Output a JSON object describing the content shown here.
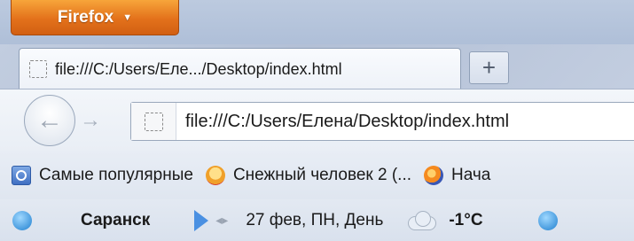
{
  "menu": {
    "firefox_label": "Firefox",
    "arrow": "▼"
  },
  "tab": {
    "title": "file:///C:/Users/Еле.../Desktop/index.html",
    "new_tab_label": "+"
  },
  "nav": {
    "back_glyph": "←",
    "forward_glyph": "→",
    "url": "file:///C:/Users/Елена/Desktop/index.html"
  },
  "bookmarks": [
    {
      "label": "Самые популярные",
      "icon": "popular-icon"
    },
    {
      "label": "Снежный человек 2 (...",
      "icon": "game-icon"
    },
    {
      "label": "Нача",
      "icon": "firefox-icon"
    }
  ],
  "weather": {
    "city": "Саранск",
    "date": "27 фев, ПН, День",
    "temperature": "-1°C",
    "scroll_glyph": "◂▸"
  }
}
